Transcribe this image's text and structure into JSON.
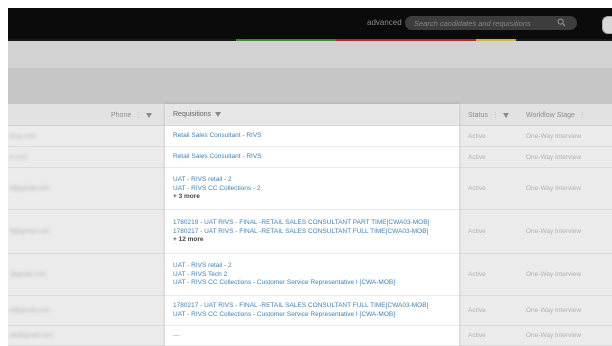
{
  "colors": {
    "topbar": "#0b0b0b",
    "link": "#3f80b8",
    "accent_segments": [
      "#1a1a1a",
      "#3b8b2e",
      "#b9262c",
      "#d2b33a",
      "#1a1a1a"
    ]
  },
  "header": {
    "advanced_label": "advanced",
    "search_placeholder": "Search candidates and requisitions",
    "search_icon": "search-icon"
  },
  "table": {
    "columns": {
      "phone": "Phone",
      "requisitions": "Requisitions",
      "status": "Status",
      "workflow": "Workflow Stage"
    },
    "rows": [
      {
        "email": "lima.com",
        "requisitions": [
          "Retail Sales Consultant - RIVS"
        ],
        "more": "",
        "status": "Active",
        "stage": "One-Way Interview"
      },
      {
        "email": "e.com",
        "requisitions": [
          "Retail Sales Consultant - RIVS"
        ],
        "more": "",
        "status": "Active",
        "stage": "One-Way Interview"
      },
      {
        "email": "8@gmail.com",
        "requisitions": [
          "UAT - RIVS retail - 2",
          "UAT - RIVS CC Collections - 2"
        ],
        "more": "+ 3 more",
        "status": "Active",
        "stage": "One-Way Interview"
      },
      {
        "email": "8@gmail.com",
        "requisitions": [
          "1780219 - UAT RIVS - FINAL -RETAIL SALES CONSULTANT PART TIME[CWA03-MOB]",
          "1780217 - UAT RIVS - FINAL -RETAIL SALES CONSULTANT FULL TIME[CWA03-MOB]"
        ],
        "more": "+ 12 more",
        "status": "Active",
        "stage": "One-Way Interview"
      },
      {
        "email": "@gmail.com",
        "requisitions": [
          "UAT - RIVS retail - 2",
          "UAT - RIVS Tech 2",
          "UAT - RIVS CC Collections - Customer Service Representative I [CWA-MOB]"
        ],
        "more": "",
        "status": "Active",
        "stage": "One-Way Interview"
      },
      {
        "email": "8@gmail.com",
        "requisitions": [
          "1780217 - UAT RIVS - FINAL -RETAIL SALES CONSULTANT FULL TIME[CWA03-MOB]",
          "UAT - RIVS CC Collections - Customer Service Representative I [CWA-MOB]"
        ],
        "more": "",
        "status": "Active",
        "stage": "One-Way Interview"
      },
      {
        "email": "ab@gmail.com",
        "requisitions": [],
        "dash": "---",
        "more": "",
        "status": "Active",
        "stage": "One-Way Interview"
      }
    ]
  }
}
